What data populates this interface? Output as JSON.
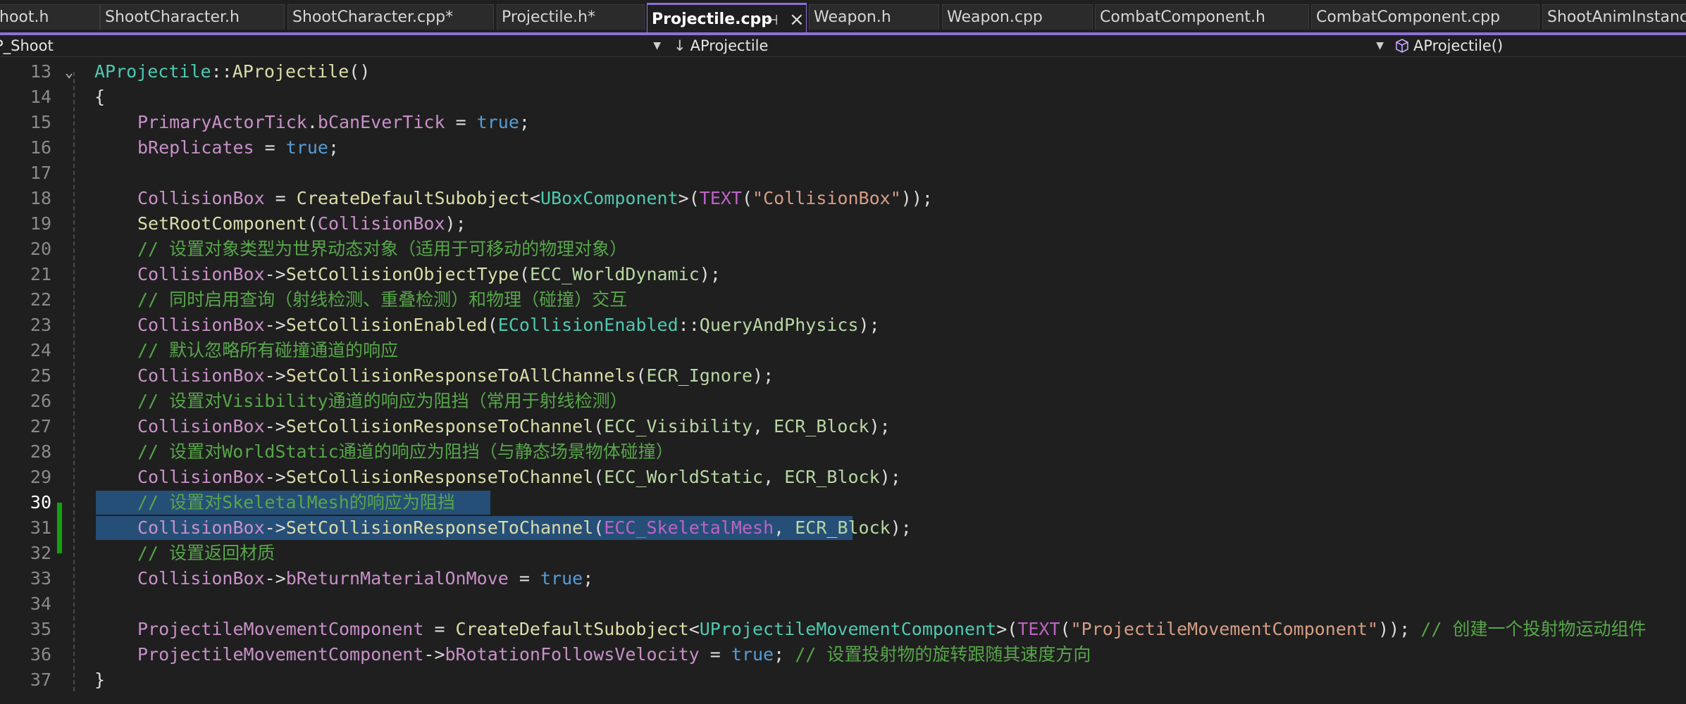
{
  "tabs": [
    {
      "label": "hoot.h",
      "active": false
    },
    {
      "label": "ShootCharacter.h",
      "active": false
    },
    {
      "label": "ShootCharacter.cpp*",
      "active": false
    },
    {
      "label": "Projectile.h*",
      "active": false
    },
    {
      "label": "Projectile.cpp",
      "active": true
    },
    {
      "label": "Weapon.h",
      "active": false
    },
    {
      "label": "Weapon.cpp",
      "active": false
    },
    {
      "label": "CombatComponent.h",
      "active": false
    },
    {
      "label": "CombatComponent.cpp",
      "active": false
    },
    {
      "label": "ShootAnimInstance",
      "active": false
    }
  ],
  "tab_icons": {
    "pin": "pin-icon",
    "close": "close-icon"
  },
  "nav": {
    "project": "P_Shoot",
    "scope_icon": "↓",
    "scope": "AProjectile",
    "member_icon": "cube-icon",
    "member": "AProjectile()"
  },
  "editor": {
    "current_line": 30,
    "lines": [
      {
        "n": "13",
        "tokens": [
          [
            "t-type",
            "AProjectile"
          ],
          [
            "t-punc",
            "::"
          ],
          [
            "t-func",
            "AProjectile"
          ],
          [
            "t-punc",
            "()"
          ]
        ]
      },
      {
        "n": "14",
        "tokens": [
          [
            "t-punc",
            "{"
          ]
        ]
      },
      {
        "n": "15",
        "tokens": [
          [
            "t-ident",
            "PrimaryActorTick"
          ],
          [
            "t-punc",
            "."
          ],
          [
            "t-ident",
            "bCanEverTick"
          ],
          [
            "t-punc",
            " = "
          ],
          [
            "t-kw",
            "true"
          ],
          [
            "t-punc",
            ";"
          ]
        ]
      },
      {
        "n": "16",
        "tokens": [
          [
            "t-ident",
            "bReplicates"
          ],
          [
            "t-punc",
            " = "
          ],
          [
            "t-kw",
            "true"
          ],
          [
            "t-punc",
            ";"
          ]
        ]
      },
      {
        "n": "17",
        "tokens": []
      },
      {
        "n": "18",
        "tokens": [
          [
            "t-ident",
            "CollisionBox"
          ],
          [
            "t-punc",
            " = "
          ],
          [
            "t-func",
            "CreateDefaultSubobject"
          ],
          [
            "t-punc",
            "<"
          ],
          [
            "t-type",
            "UBoxComponent"
          ],
          [
            "t-punc",
            ">("
          ],
          [
            "t-macro",
            "TEXT"
          ],
          [
            "t-punc",
            "("
          ],
          [
            "t-str",
            "\"CollisionBox\""
          ],
          [
            "t-punc",
            "));"
          ]
        ]
      },
      {
        "n": "19",
        "tokens": [
          [
            "t-func",
            "SetRootComponent"
          ],
          [
            "t-punc",
            "("
          ],
          [
            "t-ident",
            "CollisionBox"
          ],
          [
            "t-punc",
            ");"
          ]
        ]
      },
      {
        "n": "20",
        "tokens": [
          [
            "t-com",
            "// 设置对象类型为世界动态对象（适用于可移动的物理对象）"
          ]
        ]
      },
      {
        "n": "21",
        "tokens": [
          [
            "t-ident",
            "CollisionBox"
          ],
          [
            "t-punc",
            "->"
          ],
          [
            "t-func",
            "SetCollisionObjectType"
          ],
          [
            "t-punc",
            "("
          ],
          [
            "t-enum",
            "ECC_WorldDynamic"
          ],
          [
            "t-punc",
            ");"
          ]
        ]
      },
      {
        "n": "22",
        "tokens": [
          [
            "t-com",
            "// 同时启用查询（射线检测、重叠检测）和物理（碰撞）交互"
          ]
        ]
      },
      {
        "n": "23",
        "tokens": [
          [
            "t-ident",
            "CollisionBox"
          ],
          [
            "t-punc",
            "->"
          ],
          [
            "t-func",
            "SetCollisionEnabled"
          ],
          [
            "t-punc",
            "("
          ],
          [
            "t-type",
            "ECollisionEnabled"
          ],
          [
            "t-punc",
            "::"
          ],
          [
            "t-enum",
            "QueryAndPhysics"
          ],
          [
            "t-punc",
            ");"
          ]
        ]
      },
      {
        "n": "24",
        "tokens": [
          [
            "t-com",
            "// 默认忽略所有碰撞通道的响应"
          ]
        ]
      },
      {
        "n": "25",
        "tokens": [
          [
            "t-ident",
            "CollisionBox"
          ],
          [
            "t-punc",
            "->"
          ],
          [
            "t-func",
            "SetCollisionResponseToAllChannels"
          ],
          [
            "t-punc",
            "("
          ],
          [
            "t-enum",
            "ECR_Ignore"
          ],
          [
            "t-punc",
            ");"
          ]
        ]
      },
      {
        "n": "26",
        "tokens": [
          [
            "t-com",
            "// 设置对Visibility通道的响应为阻挡（常用于射线检测）"
          ]
        ]
      },
      {
        "n": "27",
        "tokens": [
          [
            "t-ident",
            "CollisionBox"
          ],
          [
            "t-punc",
            "->"
          ],
          [
            "t-func",
            "SetCollisionResponseToChannel"
          ],
          [
            "t-punc",
            "("
          ],
          [
            "t-enum",
            "ECC_Visibility"
          ],
          [
            "t-punc",
            ", "
          ],
          [
            "t-enum",
            "ECR_Block"
          ],
          [
            "t-punc",
            ");"
          ]
        ]
      },
      {
        "n": "28",
        "tokens": [
          [
            "t-com",
            "// 设置对WorldStatic通道的响应为阻挡（与静态场景物体碰撞）"
          ]
        ]
      },
      {
        "n": "29",
        "tokens": [
          [
            "t-ident",
            "CollisionBox"
          ],
          [
            "t-punc",
            "->"
          ],
          [
            "t-func",
            "SetCollisionResponseToChannel"
          ],
          [
            "t-punc",
            "("
          ],
          [
            "t-enum",
            "ECC_WorldStatic"
          ],
          [
            "t-punc",
            ", "
          ],
          [
            "t-enum",
            "ECR_Block"
          ],
          [
            "t-punc",
            ");"
          ]
        ]
      },
      {
        "n": "30",
        "tokens": [
          [
            "t-com",
            "// 设置对SkeletalMesh的响应为阻挡"
          ]
        ]
      },
      {
        "n": "31",
        "tokens": [
          [
            "t-ident",
            "CollisionBox"
          ],
          [
            "t-punc",
            "->"
          ],
          [
            "t-func",
            "SetCollisionResponseToChannel"
          ],
          [
            "t-punc",
            "("
          ],
          [
            "t-macro",
            "ECC_SkeletalMesh"
          ],
          [
            "t-punc",
            ", "
          ],
          [
            "t-enum",
            "ECR_Block"
          ],
          [
            "t-punc",
            ");"
          ]
        ]
      },
      {
        "n": "32",
        "tokens": [
          [
            "t-com",
            "// 设置返回材质"
          ]
        ]
      },
      {
        "n": "33",
        "tokens": [
          [
            "t-ident",
            "CollisionBox"
          ],
          [
            "t-punc",
            "->"
          ],
          [
            "t-ident",
            "bReturnMaterialOnMove"
          ],
          [
            "t-punc",
            " = "
          ],
          [
            "t-kw",
            "true"
          ],
          [
            "t-punc",
            ";"
          ]
        ]
      },
      {
        "n": "34",
        "tokens": []
      },
      {
        "n": "35",
        "tokens": [
          [
            "t-ident",
            "ProjectileMovementComponent"
          ],
          [
            "t-punc",
            " = "
          ],
          [
            "t-func",
            "CreateDefaultSubobject"
          ],
          [
            "t-punc",
            "<"
          ],
          [
            "t-type",
            "UProjectileMovementComponent"
          ],
          [
            "t-punc",
            ">("
          ],
          [
            "t-macro",
            "TEXT"
          ],
          [
            "t-punc",
            "("
          ],
          [
            "t-str",
            "\"ProjectileMovementComponent\""
          ],
          [
            "t-punc",
            "));"
          ],
          [
            "t-com",
            " // 创建一个投射物运动组件"
          ]
        ]
      },
      {
        "n": "36",
        "tokens": [
          [
            "t-ident",
            "ProjectileMovementComponent"
          ],
          [
            "t-punc",
            "->"
          ],
          [
            "t-ident",
            "bRotationFollowsVelocity"
          ],
          [
            "t-punc",
            " = "
          ],
          [
            "t-kw",
            "true"
          ],
          [
            "t-punc",
            "; "
          ],
          [
            "t-com",
            "// 设置投射物的旋转跟随其速度方向"
          ]
        ]
      },
      {
        "n": "37",
        "tokens": [
          [
            "t-punc",
            "}"
          ]
        ]
      }
    ]
  }
}
